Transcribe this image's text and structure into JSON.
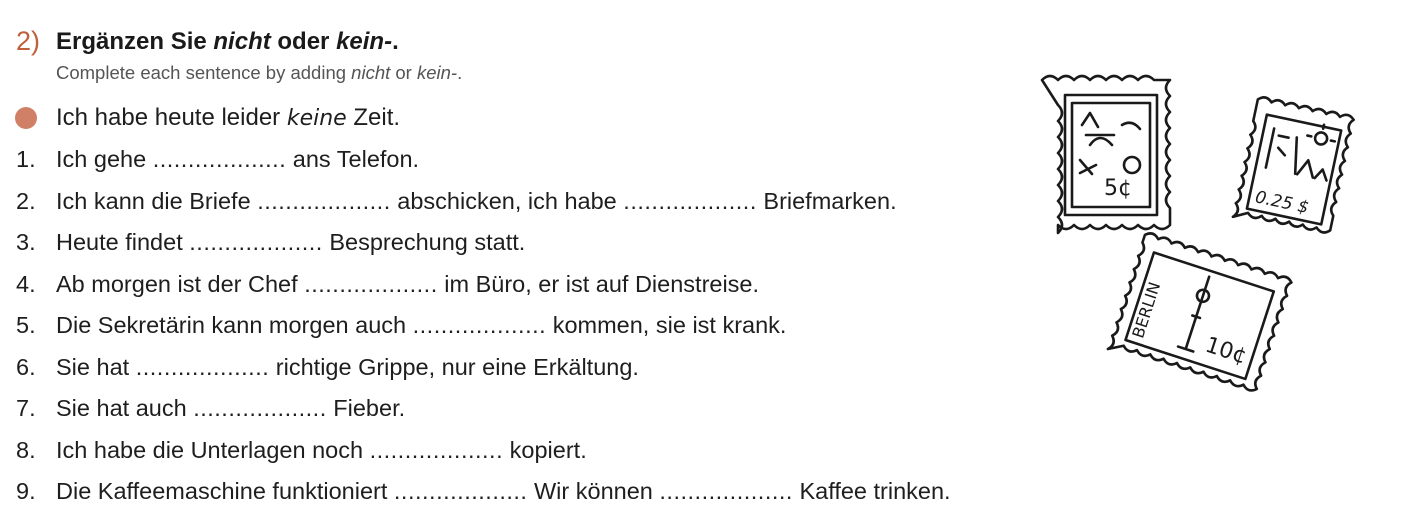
{
  "exercise": {
    "number": "2)",
    "title_parts": [
      "Ergänzen Sie ",
      "nicht",
      " oder ",
      "kein-",
      "."
    ],
    "subtitle_parts": [
      "Complete each sentence by adding ",
      "nicht",
      " or ",
      "kein-",
      "."
    ]
  },
  "example": {
    "before": "Ich habe heute leider ",
    "answer": "keine",
    "after": " Zeit."
  },
  "blank": "...................",
  "sentences": [
    {
      "num": "1.",
      "parts": [
        "Ich gehe ",
        " ans Telefon."
      ]
    },
    {
      "num": "2.",
      "parts": [
        "Ich kann die Briefe ",
        " abschicken, ich habe ",
        " Briefmarken."
      ]
    },
    {
      "num": "3.",
      "parts": [
        "Heute findet ",
        " Besprechung statt."
      ]
    },
    {
      "num": "4.",
      "parts": [
        "Ab morgen ist der Chef ",
        " im Büro, er ist auf Dienstreise."
      ]
    },
    {
      "num": "5.",
      "parts": [
        "Die Sekretärin kann morgen auch ",
        " kommen, sie ist krank."
      ]
    },
    {
      "num": "6.",
      "parts": [
        "Sie hat ",
        " richtige Grippe, nur eine Erkältung."
      ]
    },
    {
      "num": "7.",
      "parts": [
        "Sie hat auch ",
        " Fieber."
      ]
    },
    {
      "num": "8.",
      "parts": [
        "Ich habe die Unterlagen noch ",
        " kopiert."
      ]
    },
    {
      "num": "9.",
      "parts": [
        "Die Kaffeemaschine funktioniert ",
        " Wir können ",
        " Kaffee trinken."
      ]
    }
  ],
  "illustration": {
    "stamp1_value": "5¢",
    "stamp2_value": "0.25 $",
    "stamp3_city": "BERLIN",
    "stamp3_value": "10¢"
  }
}
